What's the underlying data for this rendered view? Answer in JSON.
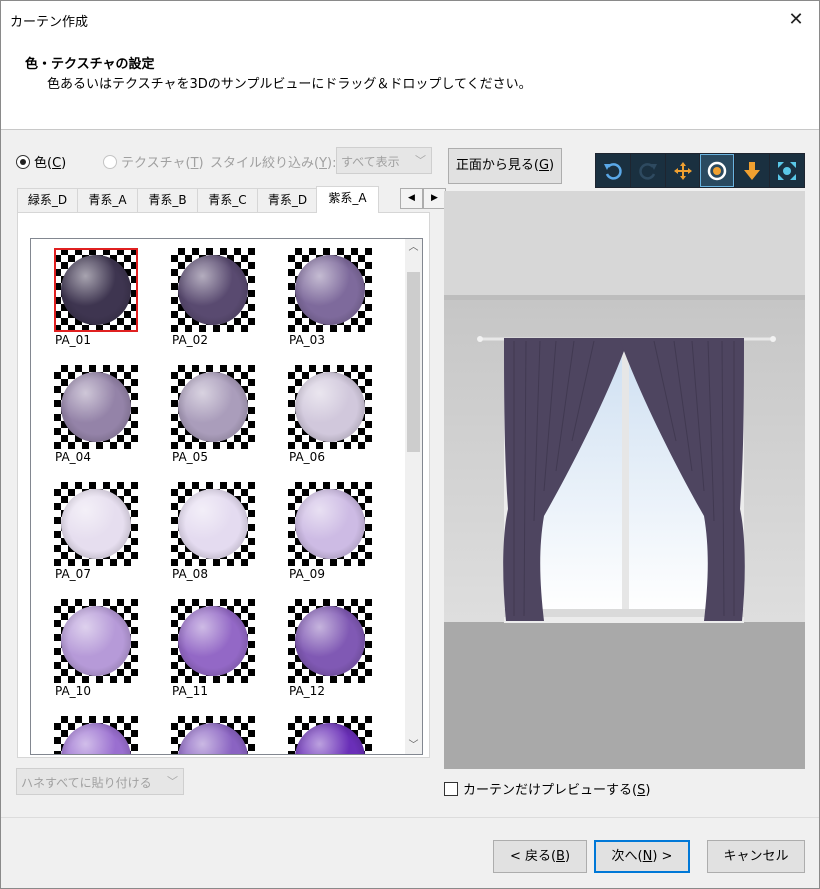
{
  "window": {
    "title": "カーテン作成"
  },
  "header": {
    "title": "色・テクスチャの設定",
    "subtitle": "色あるいはテクスチャを3Dのサンプルビューにドラッグ＆ドロップしてください。"
  },
  "mode": {
    "color_label": "色(",
    "color_key": "C",
    "color_suffix": ")",
    "texture_label": "テクスチャ(",
    "texture_key": "T",
    "texture_suffix": ")",
    "selected": "color"
  },
  "style_filter": {
    "label": "スタイル絞り込み(",
    "key": "Y",
    "suffix": "):",
    "value": "すべて表示"
  },
  "tabs": [
    "緑系_D",
    "青系_A",
    "青系_B",
    "青系_C",
    "青系_D",
    "紫系_A"
  ],
  "active_tab": "紫系_A",
  "swatches": [
    {
      "label": "PA_01",
      "color": "#3e3550",
      "selected": true
    },
    {
      "label": "PA_02",
      "color": "#594a70"
    },
    {
      "label": "PA_03",
      "color": "#7e6a9c"
    },
    {
      "label": "PA_04",
      "color": "#9483a8"
    },
    {
      "label": "PA_05",
      "color": "#aa9dbb"
    },
    {
      "label": "PA_06",
      "color": "#d1c8dc"
    },
    {
      "label": "PA_07",
      "color": "#e6deef"
    },
    {
      "label": "PA_08",
      "color": "#e4dbf0"
    },
    {
      "label": "PA_09",
      "color": "#cdbbe4"
    },
    {
      "label": "PA_10",
      "color": "#b69ad8"
    },
    {
      "label": "PA_11",
      "color": "#9368c6"
    },
    {
      "label": "PA_12",
      "color": "#8059b4"
    },
    {
      "label": "",
      "color": "#9a6fd0"
    },
    {
      "label": "",
      "color": "#8a63c2"
    },
    {
      "label": "",
      "color": "#6a2fb8"
    }
  ],
  "paste_all": {
    "label": "ハネすべてに貼り付ける"
  },
  "view": {
    "front_label": "正面から見る(",
    "front_key": "G",
    "front_suffix": ")",
    "toolbar_icons": [
      "rotate-left-icon",
      "rotate-right-icon",
      "move-icon",
      "zoom-icon",
      "down-arrow-icon",
      "fit-view-icon"
    ],
    "toolbar_selected": "zoom-icon",
    "curtain_color": "#4e4560"
  },
  "preview_only": {
    "label": "カーテンだけプレビューする(",
    "key": "S",
    "suffix": ")",
    "checked": false
  },
  "buttons": {
    "back_prefix": "< 戻る(",
    "back_key": "B",
    "back_suffix": ")",
    "next_prefix": "次へ(",
    "next_key": "N",
    "next_suffix": ") >",
    "cancel": "キャンセル"
  }
}
